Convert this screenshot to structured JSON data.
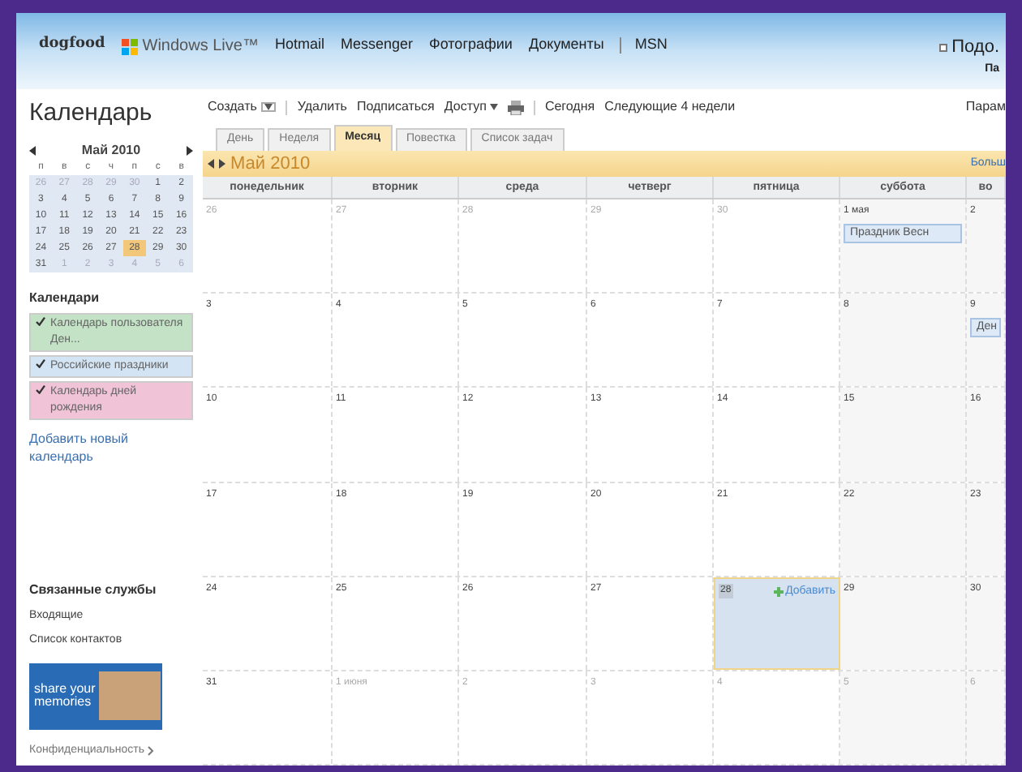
{
  "header": {
    "brand": "dogfood",
    "logo_text": "Windows Live™",
    "nav": [
      "Hotmail",
      "Messenger",
      "Фотографии",
      "Документы",
      "MSN"
    ],
    "user": "Подо.",
    "user_sub": "Па"
  },
  "sidebar": {
    "title": "Календарь",
    "mini_calendar": {
      "title": "Май 2010",
      "weekdays": [
        "п",
        "в",
        "с",
        "ч",
        "п",
        "с",
        "в"
      ],
      "weeks": [
        [
          {
            "day": "26",
            "in_month": false,
            "selected": false
          },
          {
            "day": "27",
            "in_month": false,
            "selected": false
          },
          {
            "day": "28",
            "in_month": false,
            "selected": false
          },
          {
            "day": "29",
            "in_month": false,
            "selected": false
          },
          {
            "day": "30",
            "in_month": false,
            "selected": false
          },
          {
            "day": "1",
            "in_month": true,
            "selected": false
          },
          {
            "day": "2",
            "in_month": true,
            "selected": false
          }
        ],
        [
          {
            "day": "3",
            "in_month": true,
            "selected": false
          },
          {
            "day": "4",
            "in_month": true,
            "selected": false
          },
          {
            "day": "5",
            "in_month": true,
            "selected": false
          },
          {
            "day": "6",
            "in_month": true,
            "selected": false
          },
          {
            "day": "7",
            "in_month": true,
            "selected": false
          },
          {
            "day": "8",
            "in_month": true,
            "selected": false
          },
          {
            "day": "9",
            "in_month": true,
            "selected": false
          }
        ],
        [
          {
            "day": "10",
            "in_month": true,
            "selected": false
          },
          {
            "day": "11",
            "in_month": true,
            "selected": false
          },
          {
            "day": "12",
            "in_month": true,
            "selected": false
          },
          {
            "day": "13",
            "in_month": true,
            "selected": false
          },
          {
            "day": "14",
            "in_month": true,
            "selected": false
          },
          {
            "day": "15",
            "in_month": true,
            "selected": false
          },
          {
            "day": "16",
            "in_month": true,
            "selected": false
          }
        ],
        [
          {
            "day": "17",
            "in_month": true,
            "selected": false
          },
          {
            "day": "18",
            "in_month": true,
            "selected": false
          },
          {
            "day": "19",
            "in_month": true,
            "selected": false
          },
          {
            "day": "20",
            "in_month": true,
            "selected": false
          },
          {
            "day": "21",
            "in_month": true,
            "selected": false
          },
          {
            "day": "22",
            "in_month": true,
            "selected": false
          },
          {
            "day": "23",
            "in_month": true,
            "selected": false
          }
        ],
        [
          {
            "day": "24",
            "in_month": true,
            "selected": false
          },
          {
            "day": "25",
            "in_month": true,
            "selected": false
          },
          {
            "day": "26",
            "in_month": true,
            "selected": false
          },
          {
            "day": "27",
            "in_month": true,
            "selected": false
          },
          {
            "day": "28",
            "in_month": true,
            "selected": true
          },
          {
            "day": "29",
            "in_month": true,
            "selected": false
          },
          {
            "day": "30",
            "in_month": true,
            "selected": false
          }
        ],
        [
          {
            "day": "31",
            "in_month": true,
            "selected": false
          },
          {
            "day": "1",
            "in_month": false,
            "selected": false
          },
          {
            "day": "2",
            "in_month": false,
            "selected": false
          },
          {
            "day": "3",
            "in_month": false,
            "selected": false
          },
          {
            "day": "4",
            "in_month": false,
            "selected": false
          },
          {
            "day": "5",
            "in_month": false,
            "selected": false
          },
          {
            "day": "6",
            "in_month": false,
            "selected": false
          }
        ]
      ]
    },
    "calendars_heading": "Календари",
    "calendars": [
      {
        "name": "Календарь пользователя Ден...",
        "color": "#c3e2c6",
        "checked": true
      },
      {
        "name": "Российские праздники",
        "color": "#d3e4f4",
        "checked": true
      },
      {
        "name": "Календарь дней рождения",
        "color": "#f0c4d6",
        "checked": true
      }
    ],
    "add_calendar": "Добавить новый календарь",
    "services_heading": "Связанные службы",
    "services": [
      "Входящие",
      "Список контактов"
    ],
    "banner_text": "share your memories",
    "privacy": "Конфиденциальность"
  },
  "toolbar": {
    "create": "Создать",
    "actions": [
      "Удалить",
      "Подписаться"
    ],
    "share": "Доступ",
    "today": "Сегодня",
    "range": "Следующие 4 недели",
    "options": "Парам"
  },
  "tabs": [
    {
      "label": "День",
      "selected": false
    },
    {
      "label": "Неделя",
      "selected": false
    },
    {
      "label": "Месяц",
      "selected": true
    },
    {
      "label": "Повестка",
      "selected": false
    },
    {
      "label": "Список задач",
      "selected": false
    }
  ],
  "month_bar": {
    "title": "Май 2010",
    "more": "Больш"
  },
  "columns": [
    "понедельник",
    "вторник",
    "среда",
    "четверг",
    "пятница",
    "суббота",
    "во"
  ],
  "weeks": [
    [
      {
        "label": "26",
        "in_month": false,
        "selected": false
      },
      {
        "label": "27",
        "in_month": false,
        "selected": false
      },
      {
        "label": "28",
        "in_month": false,
        "selected": false
      },
      {
        "label": "29",
        "in_month": false,
        "selected": false
      },
      {
        "label": "30",
        "in_month": false,
        "selected": false
      },
      {
        "label": "1 мая",
        "in_month": true,
        "selected": false,
        "events": [
          "Праздник Весн"
        ]
      },
      {
        "label": "2",
        "in_month": true,
        "selected": false
      }
    ],
    [
      {
        "label": "3",
        "in_month": true,
        "selected": false
      },
      {
        "label": "4",
        "in_month": true,
        "selected": false
      },
      {
        "label": "5",
        "in_month": true,
        "selected": false
      },
      {
        "label": "6",
        "in_month": true,
        "selected": false
      },
      {
        "label": "7",
        "in_month": true,
        "selected": false
      },
      {
        "label": "8",
        "in_month": true,
        "selected": false
      },
      {
        "label": "9",
        "in_month": true,
        "selected": false,
        "events": [
          "Ден"
        ]
      }
    ],
    [
      {
        "label": "10",
        "in_month": true,
        "selected": false
      },
      {
        "label": "11",
        "in_month": true,
        "selected": false
      },
      {
        "label": "12",
        "in_month": true,
        "selected": false
      },
      {
        "label": "13",
        "in_month": true,
        "selected": false
      },
      {
        "label": "14",
        "in_month": true,
        "selected": false
      },
      {
        "label": "15",
        "in_month": true,
        "selected": false
      },
      {
        "label": "16",
        "in_month": true,
        "selected": false
      }
    ],
    [
      {
        "label": "17",
        "in_month": true,
        "selected": false
      },
      {
        "label": "18",
        "in_month": true,
        "selected": false
      },
      {
        "label": "19",
        "in_month": true,
        "selected": false
      },
      {
        "label": "20",
        "in_month": true,
        "selected": false
      },
      {
        "label": "21",
        "in_month": true,
        "selected": false
      },
      {
        "label": "22",
        "in_month": true,
        "selected": false
      },
      {
        "label": "23",
        "in_month": true,
        "selected": false
      }
    ],
    [
      {
        "label": "24",
        "in_month": true,
        "selected": false
      },
      {
        "label": "25",
        "in_month": true,
        "selected": false
      },
      {
        "label": "26",
        "in_month": true,
        "selected": false
      },
      {
        "label": "27",
        "in_month": true,
        "selected": false
      },
      {
        "label": "28",
        "in_month": true,
        "selected": true,
        "add_label": "Добавить"
      },
      {
        "label": "29",
        "in_month": true,
        "selected": false
      },
      {
        "label": "30",
        "in_month": true,
        "selected": false
      }
    ],
    [
      {
        "label": "31",
        "in_month": true,
        "selected": false
      },
      {
        "label": "1 июня",
        "in_month": false,
        "selected": false
      },
      {
        "label": "2",
        "in_month": false,
        "selected": false
      },
      {
        "label": "3",
        "in_month": false,
        "selected": false
      },
      {
        "label": "4",
        "in_month": false,
        "selected": false
      },
      {
        "label": "5",
        "in_month": false,
        "selected": false
      },
      {
        "label": "6",
        "in_month": false,
        "selected": false
      }
    ]
  ]
}
